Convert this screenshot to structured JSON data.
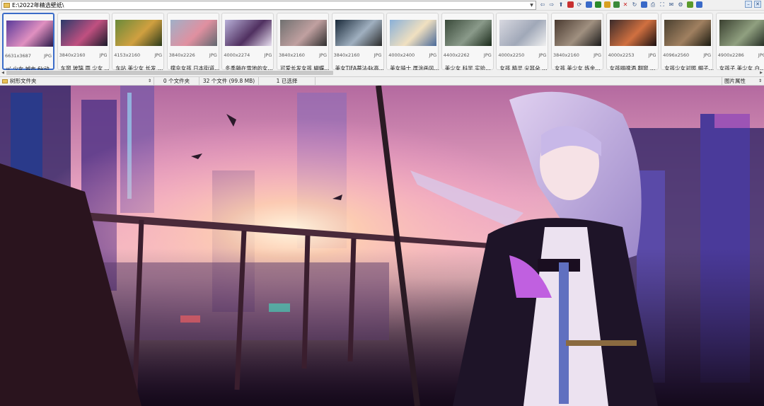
{
  "address": {
    "path": "E:\\2022年精选壁纸\\"
  },
  "toolbar": {
    "icons": [
      "back-icon",
      "forward-icon",
      "up-folder-icon",
      "folder-icon",
      "refresh-icon",
      "browse-icon",
      "slideshow-icon",
      "copy-icon",
      "move-icon",
      "delete-icon",
      "rotate-icon",
      "edit-icon",
      "print-icon",
      "fullscreen-icon",
      "email-icon",
      "settings-icon",
      "view-icon",
      "save-icon"
    ]
  },
  "thumbnails": [
    {
      "dims": "6631x3687",
      "type": "JPG",
      "caption": "u' 少女 城市 6k动漫..."
    },
    {
      "dims": "3840x2160",
      "type": "JPG",
      "caption": "车窗 玻璃 雨 少女 ..."
    },
    {
      "dims": "4153x2160",
      "type": "JPG",
      "caption": "车站 美少女 长发 漂..."
    },
    {
      "dims": "3840x2226",
      "type": "JPG",
      "caption": "撑伞女孩 日本街道..."
    },
    {
      "dims": "4000x2274",
      "type": "JPG",
      "caption": "冬季躺在雪地的女孩..."
    },
    {
      "dims": "3840x2160",
      "type": "JPG",
      "caption": "可爱长发女孩 蝴蝶..."
    },
    {
      "dims": "3840x2160",
      "type": "JPG",
      "caption": "美女TIFA蒂法4k高..."
    },
    {
      "dims": "4000x2400",
      "type": "JPG",
      "caption": "美女骑士 厚涂画风 ..."
    },
    {
      "dims": "4400x2262",
      "type": "JPG",
      "caption": "美少女 科学 实验室..."
    },
    {
      "dims": "4000x2250",
      "type": "JPG",
      "caption": "女孩 精灵 尖耳朵 蓝..."
    },
    {
      "dims": "3840x2160",
      "type": "JPG",
      "caption": "女孩 美少女 炼金术..."
    },
    {
      "dims": "4000x2253",
      "type": "JPG",
      "caption": "女孩喝啤酒 翻窗 城..."
    },
    {
      "dims": "4096x2560",
      "type": "JPG",
      "caption": "女孩少女对照 帽子 ..."
    },
    {
      "dims": "4900x2286",
      "type": "JPG",
      "caption": "女孩子 美少女 白裤..."
    }
  ],
  "status": {
    "folder_label": "树形文件夹",
    "folders": "0 个文件夹",
    "files": "32 个文件 (99.8 MB)",
    "selected": "1 已选择",
    "properties": "图片属性"
  },
  "colors": {
    "selection": "#3b6cc8",
    "chrome": "#f0f0f0",
    "folder": "#e8c25a"
  }
}
